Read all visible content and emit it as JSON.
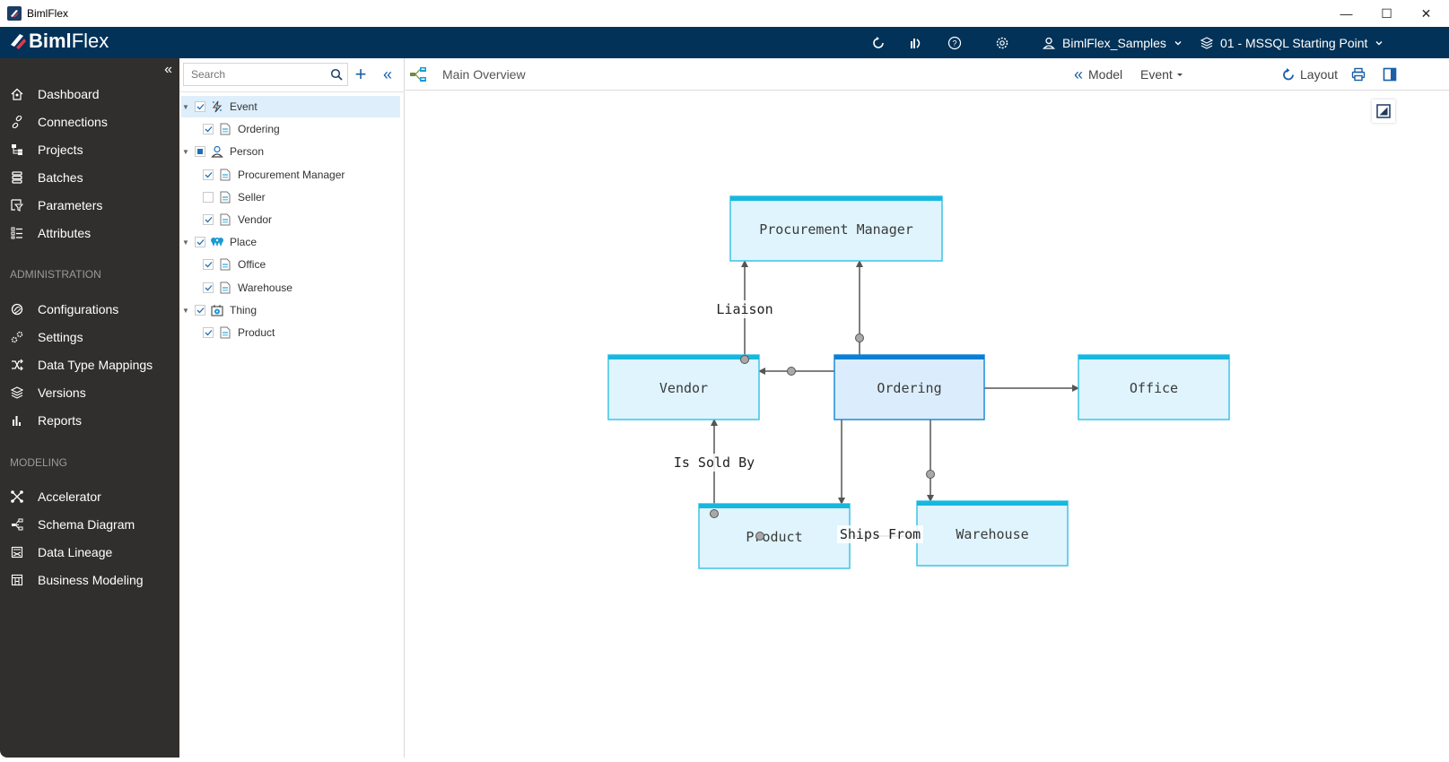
{
  "window": {
    "title": "BimlFlex",
    "controls": {
      "minimize": "—",
      "maximize": "☐",
      "close": "✕"
    }
  },
  "header": {
    "brand_bold": "Biml",
    "brand_light": "Flex",
    "icons": [
      "refresh-icon",
      "stats-icon",
      "help-icon",
      "settings-icon"
    ],
    "customer": "BimlFlex_Samples",
    "version": "01 - MSSQL Starting Point"
  },
  "sidebar": {
    "collapse_label": "«",
    "items": [
      {
        "label": "Dashboard",
        "icon": "home-icon"
      },
      {
        "label": "Connections",
        "icon": "link-icon"
      },
      {
        "label": "Projects",
        "icon": "projects-icon"
      },
      {
        "label": "Batches",
        "icon": "batches-icon"
      },
      {
        "label": "Parameters",
        "icon": "parameters-icon"
      },
      {
        "label": "Attributes",
        "icon": "attributes-icon"
      }
    ],
    "sections": [
      {
        "title": "ADMINISTRATION",
        "items": [
          {
            "label": "Configurations",
            "icon": "configurations-icon"
          },
          {
            "label": "Settings",
            "icon": "settings-icon"
          },
          {
            "label": "Data Type Mappings",
            "icon": "shuffle-icon"
          },
          {
            "label": "Versions",
            "icon": "layers-icon"
          },
          {
            "label": "Reports",
            "icon": "bar-chart-icon"
          }
        ]
      },
      {
        "title": "MODELING",
        "items": [
          {
            "label": "Accelerator",
            "icon": "accelerator-icon"
          },
          {
            "label": "Schema Diagram",
            "icon": "schema-icon"
          },
          {
            "label": "Data Lineage",
            "icon": "lineage-icon"
          },
          {
            "label": "Business Modeling",
            "icon": "business-modeling-icon"
          }
        ]
      }
    ]
  },
  "tree": {
    "search_placeholder": "Search",
    "add_label": "+",
    "collapse_label": "«",
    "rows": [
      {
        "label": "Event",
        "level": 0,
        "state": "checked",
        "icon": "event-icon",
        "selected": true
      },
      {
        "label": "Ordering",
        "level": 1,
        "state": "checked",
        "icon": "document-icon"
      },
      {
        "label": "Person",
        "level": 0,
        "state": "partial",
        "icon": "person-icon"
      },
      {
        "label": "Procurement Manager",
        "level": 1,
        "state": "checked",
        "icon": "document-icon"
      },
      {
        "label": "Seller",
        "level": 1,
        "state": "unchecked",
        "icon": "document-icon"
      },
      {
        "label": "Vendor",
        "level": 1,
        "state": "checked",
        "icon": "document-icon"
      },
      {
        "label": "Place",
        "level": 0,
        "state": "checked",
        "icon": "place-icon"
      },
      {
        "label": "Office",
        "level": 1,
        "state": "checked",
        "icon": "document-icon"
      },
      {
        "label": "Warehouse",
        "level": 1,
        "state": "checked",
        "icon": "document-icon"
      },
      {
        "label": "Thing",
        "level": 0,
        "state": "checked",
        "icon": "thing-icon"
      },
      {
        "label": "Product",
        "level": 1,
        "state": "checked",
        "icon": "document-icon"
      }
    ]
  },
  "toolbar": {
    "view_title": "Main Overview",
    "model_label": "Model",
    "filter_value": "Event",
    "layout_label": "Layout"
  },
  "diagram": {
    "colors": {
      "entity_fill": "#dff4fc",
      "entity_border": "#3ec4e6",
      "entity_header": "#16b8df",
      "focus_fill": "#dbedfc",
      "focus_border": "#1e8ad6",
      "focus_header": "#0a7fd6",
      "line": "#555555",
      "dot": "#a9a9a9"
    },
    "entities": [
      {
        "id": "pm",
        "label": "Procurement Manager",
        "focus": false
      },
      {
        "id": "vendor",
        "label": "Vendor",
        "focus": false
      },
      {
        "id": "ordering",
        "label": "Ordering",
        "focus": true
      },
      {
        "id": "office",
        "label": "Office",
        "focus": false
      },
      {
        "id": "product",
        "label": "Product",
        "focus": false
      },
      {
        "id": "warehouse",
        "label": "Warehouse",
        "focus": false
      }
    ],
    "relationships": [
      {
        "from": "vendor",
        "to": "pm",
        "label": "Liaison"
      },
      {
        "from": "ordering",
        "to": "pm",
        "label": ""
      },
      {
        "from": "ordering",
        "to": "vendor",
        "label": ""
      },
      {
        "from": "ordering",
        "to": "office",
        "label": ""
      },
      {
        "from": "ordering",
        "to": "product",
        "label": ""
      },
      {
        "from": "ordering",
        "to": "warehouse",
        "label": ""
      },
      {
        "from": "product",
        "to": "vendor",
        "label": "Is Sold By"
      },
      {
        "from": "product",
        "to": "warehouse",
        "label": "Ships From"
      }
    ]
  }
}
